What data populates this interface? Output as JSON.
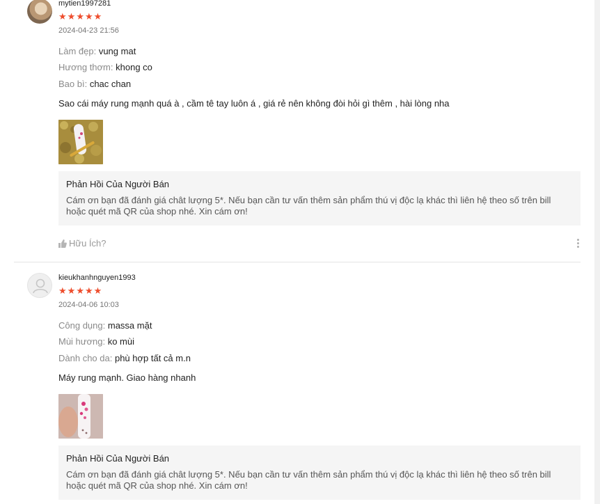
{
  "reviews": [
    {
      "username": "mytien1997281",
      "rating": 5,
      "date": "2024-04-23 21:56",
      "attributes": [
        {
          "key": "Làm đẹp:",
          "value": "vung mat"
        },
        {
          "key": "Hương thơm:",
          "value": "khong co"
        },
        {
          "key": "Bao bì:",
          "value": "chac chan"
        }
      ],
      "comment": "Sao cái máy rung mạnh quá à , cầm tê tay luôn á , giá rẻ nên không đòi hỏi gì thêm , hài lòng nha",
      "reply_title": "Phản Hồi Của Người Bán",
      "reply_text": "Cám ơn bạn đã đánh giá chât lượng 5*. Nếu bạn cần tư vấn thêm sản phẩm thú vị độc lạ khác thì liên hệ theo số trên bill hoặc quét mã QR của shop nhé. Xin cám ơn!",
      "helpful_label": "Hữu Ích?"
    },
    {
      "username": "kieukhanhnguyen1993",
      "rating": 5,
      "date": "2024-04-06 10:03",
      "attributes": [
        {
          "key": "Công dụng:",
          "value": "massa mặt"
        },
        {
          "key": "Mùi hương:",
          "value": "ko mùi"
        },
        {
          "key": "Dành cho da:",
          "value": "phù hợp tất cả m.n"
        }
      ],
      "comment": "Máy rung mạnh. Giao hàng nhanh",
      "reply_title": "Phản Hồi Của Người Bán",
      "reply_text": "Cám ơn bạn đã đánh giá chât lượng 5*. Nếu bạn cần tư vấn thêm sản phẩm thú vị độc lạ khác thì liên hệ theo số trên bill hoặc quét mã QR của shop nhé. Xin cám ơn!"
    }
  ],
  "colors": {
    "star": "#ee4d2d",
    "reply_bg": "#f5f5f5",
    "muted_text": "#8a8a8a"
  },
  "icons": {
    "star": "star-icon",
    "helpful": "thumbs-up-icon",
    "more": "more-vertical-icon"
  }
}
